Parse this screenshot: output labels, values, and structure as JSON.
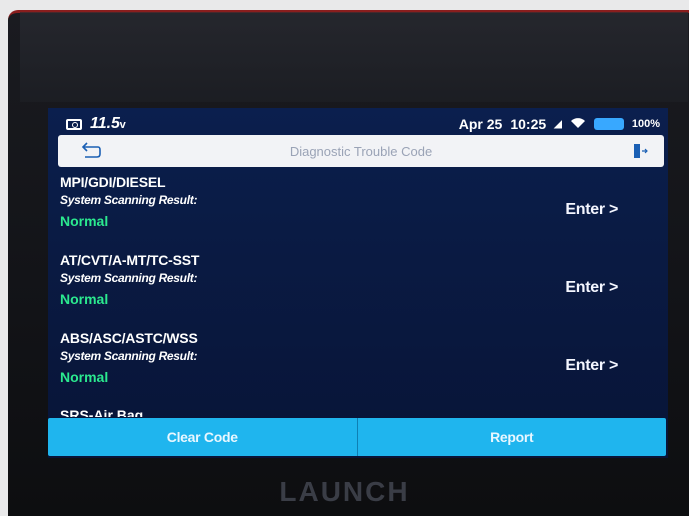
{
  "status_bar": {
    "voltage": "11.5",
    "voltage_unit": "v",
    "date": "Apr 25",
    "time": "10:25",
    "battery": "100%"
  },
  "header": {
    "title": "Diagnostic Trouble Code"
  },
  "systems": [
    {
      "name": "MPI/GDI/DIESEL",
      "label": "System Scanning Result:",
      "status": "Normal",
      "action": "Enter >"
    },
    {
      "name": "AT/CVT/A-MT/TC-SST",
      "label": "System Scanning Result:",
      "status": "Normal",
      "action": "Enter >"
    },
    {
      "name": "ABS/ASC/ASTC/WSS",
      "label": "System Scanning Result:",
      "status": "Normal",
      "action": "Enter >"
    }
  ],
  "partial_item": "SRS-Air Bag",
  "footer": {
    "clear_code": "Clear Code",
    "report": "Report"
  },
  "brand": "LAUNCH",
  "colors": {
    "accent": "#1fb5ee",
    "status_normal": "#2be98f",
    "screen_bg": "#0a1b44"
  }
}
